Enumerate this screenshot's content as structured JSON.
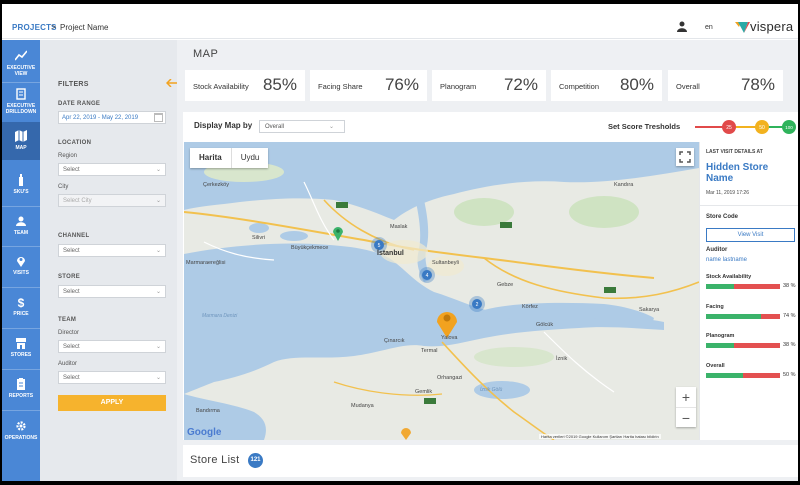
{
  "header": {
    "breadcrumb_root": "PROJECTS",
    "breadcrumb_separator": ">",
    "project_name": "Project Name",
    "language": "en",
    "brand": "vispera"
  },
  "nav": {
    "items": [
      {
        "label": "EXECUTIVE VIEW",
        "icon": "trend-chart-icon",
        "active": false
      },
      {
        "label": "EXECUTIVE DRILLDOWN",
        "icon": "drilldown-icon",
        "active": false
      },
      {
        "label": "MAP",
        "icon": "map-icon",
        "active": true
      },
      {
        "label": "SKU'S",
        "icon": "bottle-icon",
        "active": false
      },
      {
        "label": "TEAM",
        "icon": "team-icon",
        "active": false
      },
      {
        "label": "VISITS",
        "icon": "location-pin-icon",
        "active": false
      },
      {
        "label": "PRICE",
        "icon": "dollar-icon",
        "active": false
      },
      {
        "label": "STORES",
        "icon": "store-icon",
        "active": false
      },
      {
        "label": "REPORTS",
        "icon": "clipboard-icon",
        "active": false
      },
      {
        "label": "OPERATIONS",
        "icon": "gear-icon",
        "active": false
      }
    ]
  },
  "filters": {
    "title": "FILTERS",
    "date_range_label": "DATE RANGE",
    "date_range_value": "Apr 22, 2019  -  May 22, 2019",
    "location_label": "LOCATION",
    "region_label": "Region",
    "region_value": "Select",
    "city_label": "City",
    "city_value": "Select City",
    "channel_label": "CHANNEL",
    "channel_value": "Select",
    "store_label": "STORE",
    "store_value": "Select",
    "team_label": "TEAM",
    "director_label": "Director",
    "director_value": "Select",
    "auditor_label": "Auditor",
    "auditor_value": "Select",
    "apply_label": "APPLY"
  },
  "page": {
    "title": "MAP"
  },
  "kpis": [
    {
      "label": "Stock Availability",
      "value": "85%"
    },
    {
      "label": "Facing Share",
      "value": "76%"
    },
    {
      "label": "Planogram",
      "value": "72%"
    },
    {
      "label": "Competition",
      "value": "80%"
    },
    {
      "label": "Overall",
      "value": "78%"
    }
  ],
  "map_controls": {
    "display_map_by_label": "Display Map by",
    "display_map_by_value": "Overall",
    "thresholds_label": "Set Score Tresholds",
    "thresholds": [
      "25",
      "50",
      "100"
    ],
    "threshold_colors": [
      "#e14a4a",
      "#f2b21f",
      "#2fb35b"
    ],
    "map_type_tabs": [
      "Harita",
      "Uydu"
    ],
    "map_type_selected": "Harita",
    "zoom_in": "+",
    "zoom_out": "−",
    "google_logo": "Google",
    "attribution": "Harita verileri ©2019 Google   Kullanım Şartları   Harita hatası bildirin"
  },
  "map_places": [
    {
      "name": "İstanbul",
      "big": true
    },
    {
      "name": "Çerkezköy"
    },
    {
      "name": "Silivri"
    },
    {
      "name": "Büyükçekmece"
    },
    {
      "name": "Marmaraereğlisi"
    },
    {
      "name": "Sultanbeyli"
    },
    {
      "name": "Gebze"
    },
    {
      "name": "Körfez"
    },
    {
      "name": "Gölcük"
    },
    {
      "name": "Yalova"
    },
    {
      "name": "Termal"
    },
    {
      "name": "Çınarcık"
    },
    {
      "name": "Orhangazi"
    },
    {
      "name": "Gemlik"
    },
    {
      "name": "Mudanya"
    },
    {
      "name": "Bandırma"
    },
    {
      "name": "Sakarya"
    },
    {
      "name": "Maslak"
    },
    {
      "name": "Kandıra"
    },
    {
      "name": "İznik"
    }
  ],
  "map_seas": [
    "Marmara Denizi",
    "İznik Gölü"
  ],
  "map_markers": [
    {
      "type": "cluster",
      "count": "5"
    },
    {
      "type": "cluster",
      "count": "4"
    },
    {
      "type": "cluster",
      "count": "2"
    },
    {
      "type": "pin",
      "color": "#3bb36a"
    },
    {
      "type": "pin",
      "color": "#f2a21f"
    }
  ],
  "last_visit": {
    "heading": "LAST VISIT DETAILS AT",
    "store_name": "Hidden Store Name",
    "date": "Mar 11, 2019 17:26",
    "store_code_label": "Store Code",
    "view_visit_label": "View Visit",
    "auditor_label": "Auditor",
    "auditor_name": "name lastname",
    "metrics": [
      {
        "label": "Stock Availability",
        "value": 38,
        "text": "38 %"
      },
      {
        "label": "Facing",
        "value": 74,
        "text": "74 %"
      },
      {
        "label": "Planogram",
        "value": 38,
        "text": "38 %"
      },
      {
        "label": "Overall",
        "value": 50,
        "text": "50 %"
      }
    ]
  },
  "store_list": {
    "title": "Store List",
    "count": "121"
  }
}
